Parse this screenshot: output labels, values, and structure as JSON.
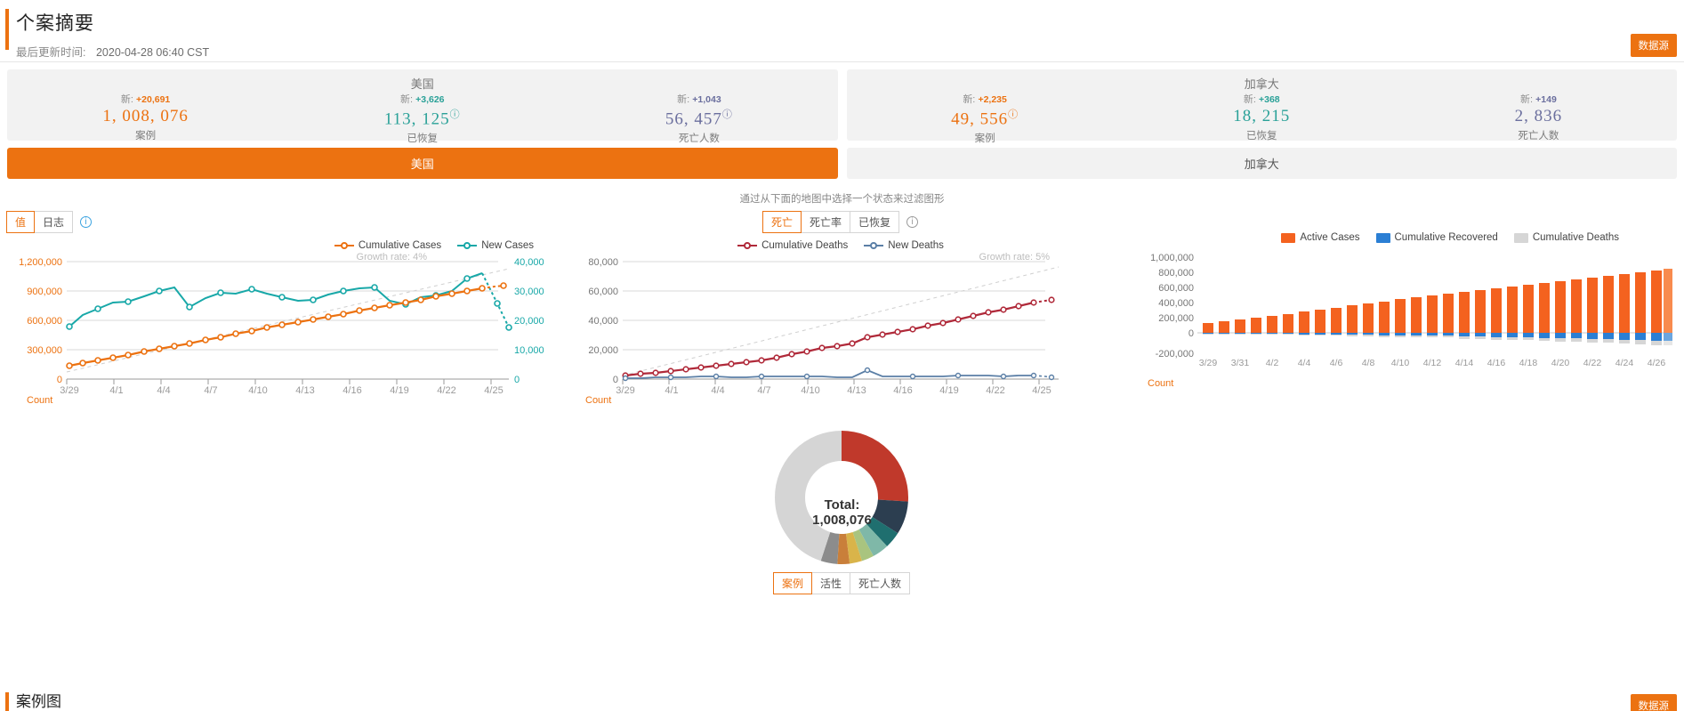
{
  "header": {
    "title": "个案摘要",
    "updated_label": "最后更新时间:",
    "updated_time": "2020-04-28 06:40 CST",
    "datasource_button": "数据源"
  },
  "colors": {
    "accent": "#ec7211",
    "cases": "#ec7211",
    "recovered": "#2aa198",
    "deaths": "#6b6f9e",
    "cumulative_deaths_line": "#b02a3a",
    "new_deaths_line": "#5b7fa6",
    "new_cases_line": "#18a8a8",
    "bar_active": "#f4621f",
    "bar_recovered": "#2b7fd4",
    "bar_deaths": "#d6d6d6"
  },
  "cards": [
    {
      "title": "美国",
      "stats": [
        {
          "new_label": "新:",
          "new_value": "+20,691",
          "value": "1, 008, 076",
          "label": "案例",
          "color_key": "cases",
          "info": false
        },
        {
          "new_label": "新:",
          "new_value": "+3,626",
          "value": "113, 125",
          "label": "已恢复",
          "color_key": "recovered",
          "info": true
        },
        {
          "new_label": "新:",
          "new_value": "+1,043",
          "value": "56, 457",
          "label": "死亡人数",
          "color_key": "deaths",
          "info": true
        }
      ]
    },
    {
      "title": "加拿大",
      "stats": [
        {
          "new_label": "新:",
          "new_value": "+2,235",
          "value": "49, 556",
          "label": "案例",
          "color_key": "cases",
          "info": true
        },
        {
          "new_label": "新:",
          "new_value": "+368",
          "value": "18, 215",
          "label": "已恢复",
          "color_key": "recovered",
          "info": false
        },
        {
          "new_label": "新:",
          "new_value": "+149",
          "value": "2, 836",
          "label": "死亡人数",
          "color_key": "deaths",
          "info": false
        }
      ]
    }
  ],
  "country_tabs": [
    {
      "label": "美国",
      "active": true
    },
    {
      "label": "加拿大",
      "active": false
    }
  ],
  "filter_hint": "通过从下面的地图中选择一个状态来过滤图形",
  "chart1": {
    "toggle": [
      {
        "label": "值",
        "on": true
      },
      {
        "label": "日志",
        "on": false
      }
    ],
    "info_icon": "info-icon",
    "legend": [
      {
        "label": "Cumulative Cases",
        "color": "#ec7211"
      },
      {
        "label": "New Cases",
        "color": "#18a8a8"
      }
    ],
    "growth_note": "Growth rate: 4%",
    "axis_name": "Count"
  },
  "chart2": {
    "toggle": [
      {
        "label": "死亡",
        "on": true
      },
      {
        "label": "死亡率",
        "on": false
      },
      {
        "label": "已恢复",
        "on": false
      }
    ],
    "legend": [
      {
        "label": "Cumulative Deaths",
        "color": "#b02a3a"
      },
      {
        "label": "New Deaths",
        "color": "#5b7fa6"
      }
    ],
    "growth_note": "Growth rate: 5%",
    "axis_name": "Count"
  },
  "chart3": {
    "legend": [
      {
        "label": "Active Cases",
        "color": "#f4621f"
      },
      {
        "label": "Cumulative Recovered",
        "color": "#2b7fd4"
      },
      {
        "label": "Cumulative Deaths",
        "color": "#d6d6d6"
      }
    ],
    "axis_name": "Count"
  },
  "donut": {
    "total_label": "Total:",
    "total_value": "1,008,076",
    "tabs": [
      {
        "label": "案例",
        "on": true
      },
      {
        "label": "活性",
        "on": false
      },
      {
        "label": "死亡人数",
        "on": false
      }
    ]
  },
  "footer": {
    "title": "案例图",
    "button": "数据源"
  },
  "chart_data": [
    {
      "type": "line",
      "id": "cases-chart",
      "title": "",
      "xlabel": "Count",
      "ylabel": "",
      "ylim": [
        0,
        1200000
      ],
      "y2lim": [
        0,
        40000
      ],
      "yticks": [
        0,
        300000,
        600000,
        900000,
        1200000
      ],
      "ytick_labels": [
        "0",
        "300,000",
        "600,000",
        "900,000",
        "1,200,000"
      ],
      "y2ticks": [
        0,
        10000,
        20000,
        30000,
        40000
      ],
      "y2tick_labels": [
        "0",
        "10,000",
        "20,000",
        "30,000",
        "40,000"
      ],
      "xtick_labels": [
        "3/29",
        "4/1",
        "4/4",
        "4/7",
        "4/10",
        "4/13",
        "4/16",
        "4/19",
        "4/22",
        "4/25"
      ],
      "x": [
        "3/29",
        "3/30",
        "3/31",
        "4/1",
        "4/2",
        "4/3",
        "4/4",
        "4/5",
        "4/6",
        "4/7",
        "4/8",
        "4/9",
        "4/10",
        "4/11",
        "4/12",
        "4/13",
        "4/14",
        "4/15",
        "4/16",
        "4/17",
        "4/18",
        "4/19",
        "4/20",
        "4/21",
        "4/22",
        "4/23",
        "4/24",
        "4/25",
        "4/26",
        "4/27"
      ],
      "series": [
        {
          "name": "Cumulative Cases",
          "color": "#ec7211",
          "axis": "left",
          "values": [
            140000,
            163000,
            188000,
            215000,
            245000,
            277000,
            312000,
            337000,
            367000,
            400000,
            432000,
            465000,
            497000,
            527000,
            556000,
            583000,
            609000,
            637000,
            668000,
            700000,
            733000,
            760000,
            788000,
            819000,
            849000,
            880000,
            911000,
            940000,
            966000,
            987000
          ]
        },
        {
          "name": "New Cases",
          "color": "#18a8a8",
          "axis": "right",
          "values": [
            18600,
            20900,
            23900,
            26000,
            29100,
            31800,
            34100,
            25400,
            29300,
            32500,
            32000,
            32800,
            34400,
            30300,
            27900,
            26200,
            26600,
            29500,
            31000,
            32200,
            33200,
            27300,
            25800,
            28300,
            29200,
            31000,
            36000,
            38000,
            27000,
            20300
          ]
        }
      ],
      "trend": {
        "name": "Growth rate trend",
        "annotation": "Growth rate: 4%",
        "style": "dashed",
        "color": "#cccccc"
      },
      "grid": true,
      "legend_position": "top-right"
    },
    {
      "type": "line",
      "id": "deaths-chart",
      "title": "",
      "xlabel": "Count",
      "ylabel": "",
      "ylim": [
        0,
        80000
      ],
      "yticks": [
        0,
        20000,
        40000,
        60000,
        80000
      ],
      "ytick_labels": [
        "0",
        "20,000",
        "40,000",
        "60,000",
        "80,000"
      ],
      "xtick_labels": [
        "3/29",
        "4/1",
        "4/4",
        "4/7",
        "4/10",
        "4/13",
        "4/16",
        "4/19",
        "4/22",
        "4/25"
      ],
      "x": [
        "3/29",
        "3/30",
        "3/31",
        "4/1",
        "4/2",
        "4/3",
        "4/4",
        "4/5",
        "4/6",
        "4/7",
        "4/8",
        "4/9",
        "4/10",
        "4/11",
        "4/12",
        "4/13",
        "4/14",
        "4/15",
        "4/16",
        "4/17",
        "4/18",
        "4/19",
        "4/20",
        "4/21",
        "4/22",
        "4/23",
        "4/24",
        "4/25",
        "4/26",
        "4/27"
      ],
      "series": [
        {
          "name": "Cumulative Deaths",
          "color": "#b02a3a",
          "values": [
            2500,
            3000,
            3800,
            4800,
            6000,
            7400,
            9000,
            10000,
            11000,
            13000,
            15000,
            17000,
            19000,
            21000,
            22500,
            23800,
            28000,
            30000,
            32000,
            34000,
            36000,
            38000,
            40500,
            43000,
            45500,
            47500,
            50000,
            52500,
            54500,
            56457
          ]
        },
        {
          "name": "New Deaths",
          "color": "#5b7fa6",
          "values": [
            500,
            600,
            800,
            1000,
            1200,
            1400,
            1600,
            1000,
            1100,
            2000,
            2000,
            2000,
            2000,
            1700,
            1500,
            1300,
            4200,
            2000,
            2000,
            2000,
            2000,
            1800,
            2500,
            2500,
            2500,
            2000,
            2500,
            2500,
            1900,
            1043
          ]
        }
      ],
      "trend": {
        "name": "Growth rate trend",
        "annotation": "Growth rate: 5%",
        "style": "dashed",
        "color": "#cccccc"
      },
      "grid": true,
      "legend_position": "top-center"
    },
    {
      "type": "bar",
      "id": "stacked-breakdown-chart",
      "title": "",
      "xlabel": "Count",
      "stacked": true,
      "ylim": [
        -200000,
        1000000
      ],
      "yticks": [
        -200000,
        0,
        200000,
        400000,
        600000,
        800000,
        1000000
      ],
      "ytick_labels": [
        "-200,000",
        "0",
        "200,000",
        "400,000",
        "600,000",
        "800,000",
        "1,000,000"
      ],
      "xtick_labels": [
        "3/29",
        "3/31",
        "4/2",
        "4/4",
        "4/6",
        "4/8",
        "4/10",
        "4/12",
        "4/14",
        "4/16",
        "4/18",
        "4/20",
        "4/22",
        "4/24",
        "4/26"
      ],
      "categories": [
        "3/29",
        "3/30",
        "3/31",
        "4/1",
        "4/2",
        "4/3",
        "4/4",
        "4/5",
        "4/6",
        "4/7",
        "4/8",
        "4/9",
        "4/10",
        "4/11",
        "4/12",
        "4/13",
        "4/14",
        "4/15",
        "4/16",
        "4/17",
        "4/18",
        "4/19",
        "4/20",
        "4/21",
        "4/22",
        "4/23",
        "4/24",
        "4/25",
        "4/26",
        "4/27"
      ],
      "series": [
        {
          "name": "Active Cases",
          "color": "#f4621f",
          "values": [
            133000,
            154000,
            177000,
            201000,
            228000,
            256000,
            287000,
            308000,
            334000,
            362000,
            388000,
            415000,
            441000,
            465000,
            487000,
            508000,
            528000,
            549000,
            572000,
            596000,
            620000,
            640000,
            659000,
            682000,
            703000,
            726000,
            748000,
            770000,
            790000,
            838000
          ]
        },
        {
          "name": "Cumulative Recovered",
          "color": "#2b7fd4",
          "values": [
            -4600,
            -5700,
            -7000,
            -8500,
            -9000,
            -9700,
            -14800,
            -17400,
            -19600,
            -21000,
            -23000,
            -25000,
            -27000,
            -31000,
            -33000,
            -36000,
            -42000,
            -47000,
            -53000,
            -58000,
            -64000,
            -70000,
            -72000,
            -75000,
            -82000,
            -88000,
            -95000,
            -102000,
            -109000,
            -113125
          ]
        },
        {
          "name": "Cumulative Deaths",
          "color": "#d6d6d6",
          "values": [
            -2500,
            -3000,
            -3800,
            -4800,
            -6000,
            -7400,
            -9000,
            -10000,
            -11000,
            -13000,
            -15000,
            -17000,
            -19000,
            -21000,
            -22500,
            -23800,
            -28000,
            -30000,
            -32000,
            -34000,
            -36000,
            -38000,
            -40500,
            -43000,
            -45500,
            -47500,
            -50000,
            -52500,
            -54500,
            -56457
          ]
        }
      ],
      "grid": false,
      "legend_position": "top-right"
    },
    {
      "type": "pie",
      "id": "state-breakdown-donut",
      "title": "Total: 1,008,076",
      "center_label": "Total:",
      "center_value": "1,008,076",
      "slices": [
        {
          "label": "slice-1",
          "color": "#c0392b",
          "value": 26
        },
        {
          "label": "slice-2",
          "color": "#2c3e50",
          "value": 8
        },
        {
          "label": "slice-3",
          "color": "#1f6f6f",
          "value": 4
        },
        {
          "label": "slice-4",
          "color": "#7fb8a8",
          "value": 4
        },
        {
          "label": "slice-5",
          "color": "#a9c47f",
          "value": 3
        },
        {
          "label": "slice-6",
          "color": "#d9b44a",
          "value": 3
        },
        {
          "label": "slice-7",
          "color": "#c97f3a",
          "value": 3
        },
        {
          "label": "slice-8",
          "color": "#8c8c8c",
          "value": 4
        },
        {
          "label": "slice-9",
          "color": "#d5d5d5",
          "value": 45
        }
      ]
    }
  ]
}
